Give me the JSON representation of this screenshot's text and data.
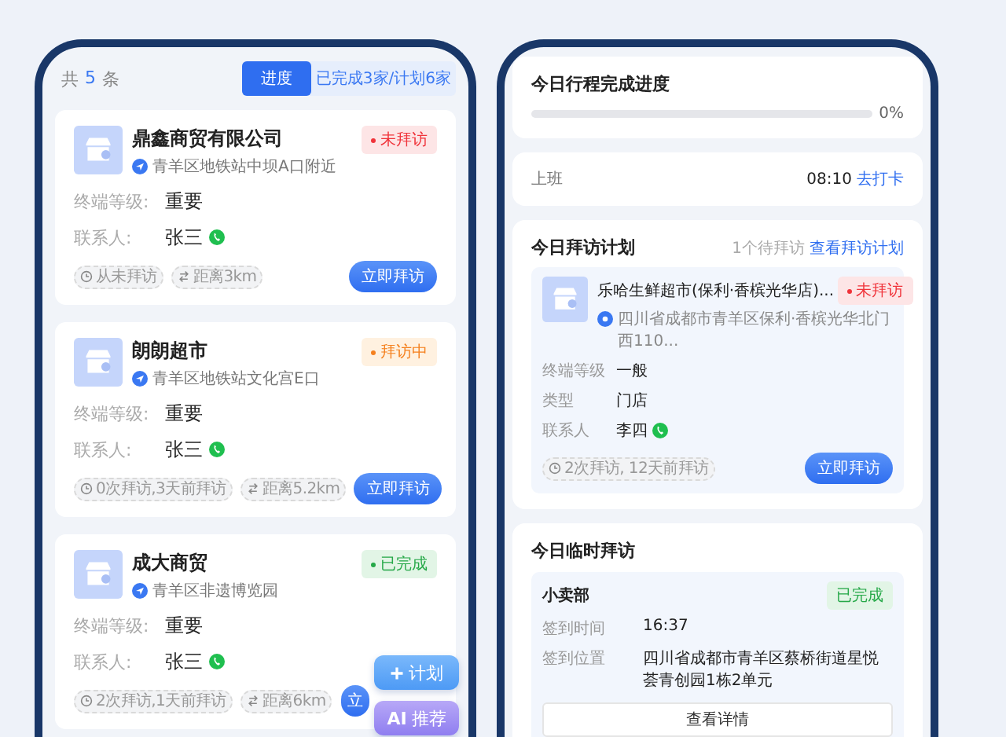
{
  "list_panel": {
    "total": {
      "prefix": "共",
      "count": "5",
      "suffix": "条"
    },
    "tabs": [
      {
        "label": "进度",
        "selected": true
      },
      {
        "label": "已完成3家/计划6家",
        "selected": false
      }
    ],
    "stores": [
      {
        "name": "鼎鑫商贸有限公司",
        "address": "青羊区地铁站中坝A口附近",
        "status": {
          "kind": "pending",
          "label": "未拜访",
          "dot": true
        },
        "fields": [
          {
            "label": "终端等级:",
            "value": "重要",
            "kind": "text"
          },
          {
            "label": "联系人:",
            "value": "张三",
            "kind": "contact"
          }
        ],
        "tags": [
          {
            "kind": "history",
            "text": "从未拜访"
          },
          {
            "kind": "distance",
            "text": "距离3km"
          }
        ],
        "button": "立即拜访"
      },
      {
        "name": "朗朗超市",
        "address": "青羊区地铁站文化宫E口",
        "status": {
          "kind": "visiting",
          "label": "拜访中",
          "dot": true
        },
        "fields": [
          {
            "label": "终端等级:",
            "value": "重要",
            "kind": "text"
          },
          {
            "label": "联系人:",
            "value": "张三",
            "kind": "contact"
          }
        ],
        "tags": [
          {
            "kind": "history",
            "text": "0次拜访,3天前拜访"
          },
          {
            "kind": "distance",
            "text": "距离5.2km"
          }
        ],
        "button": "立即拜访"
      },
      {
        "name": "成大商贸",
        "address": "青羊区非遗博览园",
        "status": {
          "kind": "done",
          "label": "已完成",
          "dot": true
        },
        "fields": [
          {
            "label": "终端等级:",
            "value": "重要",
            "kind": "text"
          },
          {
            "label": "联系人:",
            "value": "张三",
            "kind": "contact"
          }
        ],
        "tags": [
          {
            "kind": "history",
            "text": "2次拜访,1天前拜访"
          },
          {
            "kind": "distance",
            "text": "距离6km"
          }
        ],
        "button": "立"
      }
    ],
    "floating_buttons": [
      {
        "kind": "plan",
        "label": "计划"
      },
      {
        "kind": "ai",
        "badge": "AI",
        "label": "推荐"
      }
    ]
  },
  "today_panel": {
    "progress": {
      "title": "今日行程完成进度",
      "level": 0,
      "reading": "0%"
    },
    "checkin": {
      "label": "上班",
      "time": "08:10",
      "link": "去打卡"
    },
    "plan": {
      "title": "今日拜访计划",
      "pending": "1个待拜访",
      "link": "查看拜访计划",
      "store": {
        "name": "乐哈生鲜超市(保利·香槟光华店)...",
        "address": "四川省成都市青羊区保利·香槟光华北门西110...",
        "status": {
          "kind": "pending",
          "label": "未拜访",
          "dot": true
        },
        "fields": [
          {
            "label": "终端等级",
            "value": "一般",
            "kind": "text"
          },
          {
            "label": "类型",
            "value": "门店",
            "kind": "text"
          },
          {
            "label": "联系人",
            "value": "李四",
            "kind": "contact"
          }
        ],
        "tag": "2次拜访, 12天前拜访",
        "button": "立即拜访"
      }
    },
    "temporary": {
      "title": "今日临时拜访",
      "visit": {
        "name": "小卖部",
        "status": {
          "kind": "done",
          "label": "已完成",
          "dot": false
        },
        "fields": [
          {
            "label": "签到时间",
            "value": "16:37"
          },
          {
            "label": "签到位置",
            "value": "四川省成都市青羊区蔡桥街道星悦荟青创园1栋2单元"
          }
        ],
        "button": "查看详情"
      }
    }
  }
}
